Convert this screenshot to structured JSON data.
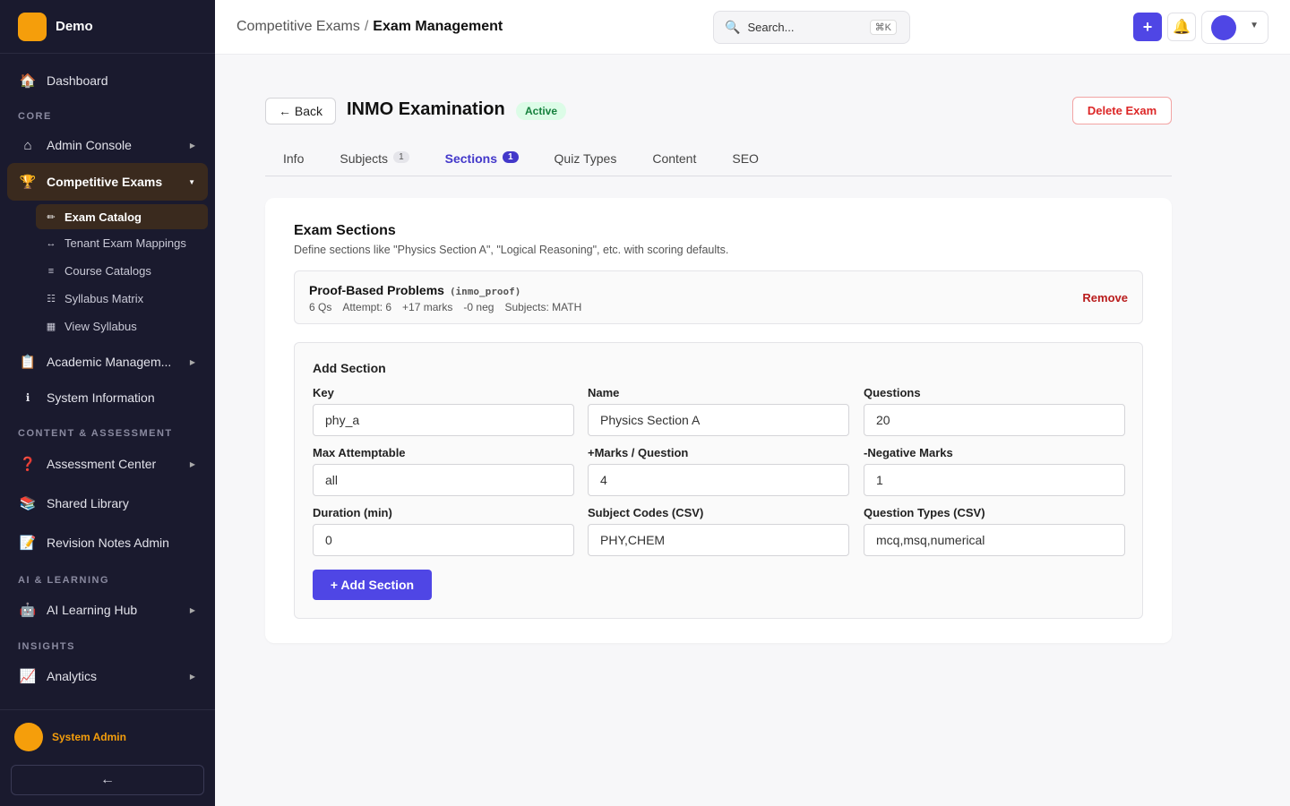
{
  "brand": {
    "name": "Demo"
  },
  "sidebar": {
    "items": [
      {
        "label": "Dashboard",
        "icon": "🏠"
      },
      {
        "section": "CORE"
      },
      {
        "label": "Admin Console",
        "icon": "⌂"
      },
      {
        "label": "Competitive Exams",
        "icon": "🏆"
      },
      {
        "label": "Academic Managem...",
        "icon": "📋"
      },
      {
        "label": "System Information",
        "icon": "ℹ"
      },
      {
        "section": "CONTENT & ASSESSMENT"
      },
      {
        "label": "Assessment Center",
        "icon": "❓"
      },
      {
        "label": "Shared Library",
        "icon": "📚"
      },
      {
        "label": "Revision Notes Admin",
        "icon": "📝"
      },
      {
        "section": "AI & LEARNING"
      },
      {
        "label": "AI Learning Hub",
        "icon": "🤖"
      },
      {
        "section": "INSIGHTS"
      },
      {
        "label": "Analytics",
        "icon": "📈"
      }
    ],
    "subitems": [
      {
        "label": "Exam Catalog",
        "icon": "✏"
      },
      {
        "label": "Tenant Exam Mappings",
        "icon": "↔"
      },
      {
        "label": "Course Catalogs",
        "icon": "≡"
      },
      {
        "label": "Syllabus Matrix",
        "icon": "☷"
      },
      {
        "label": "View Syllabus",
        "icon": "▦"
      }
    ],
    "user": {
      "name": "System Admin"
    },
    "collapse_icon": "←"
  },
  "header": {
    "breadcrumb_parent": "Competitive Exams",
    "breadcrumb_sep": "/",
    "breadcrumb_current": "Exam Management",
    "search_placeholder": "Search...",
    "search_shortcut": "⌘K",
    "plus": "+",
    "bell": "🔔",
    "caret": "▼"
  },
  "exam": {
    "back_label": "← Back",
    "title": "INMO Examination",
    "status": "Active",
    "delete_label": "Delete Exam"
  },
  "tabs": [
    {
      "label": "Info"
    },
    {
      "label": "Subjects",
      "count": "1"
    },
    {
      "label": "Sections",
      "count": "1"
    },
    {
      "label": "Quiz Types"
    },
    {
      "label": "Content"
    },
    {
      "label": "SEO"
    }
  ],
  "sections_card": {
    "title": "Exam Sections",
    "description": "Define sections like \"Physics Section A\", \"Logical Reasoning\", etc. with scoring defaults.",
    "existing": {
      "name": "Proof-Based Problems",
      "key": "(inmo_proof)",
      "questions": "6 Qs",
      "attempt": "Attempt: 6",
      "marks": "+17 marks",
      "neg": "-0 neg",
      "subjects": "Subjects: MATH",
      "remove_label": "Remove"
    },
    "add": {
      "title": "Add Section",
      "fields": [
        {
          "label": "Key",
          "value": "phy_a"
        },
        {
          "label": "Name",
          "value": "Physics Section A"
        },
        {
          "label": "Questions",
          "value": "20"
        },
        {
          "label": "Max Attemptable",
          "value": "all"
        },
        {
          "label": "+Marks / Question",
          "value": "4"
        },
        {
          "label": "-Negative Marks",
          "value": "1"
        },
        {
          "label": "Duration (min)",
          "value": "0"
        },
        {
          "label": "Subject Codes (CSV)",
          "value": "PHY,CHEM"
        },
        {
          "label": "Question Types (CSV)",
          "value": "mcq,msq,numerical"
        }
      ],
      "button_label": "+ Add Section"
    }
  }
}
